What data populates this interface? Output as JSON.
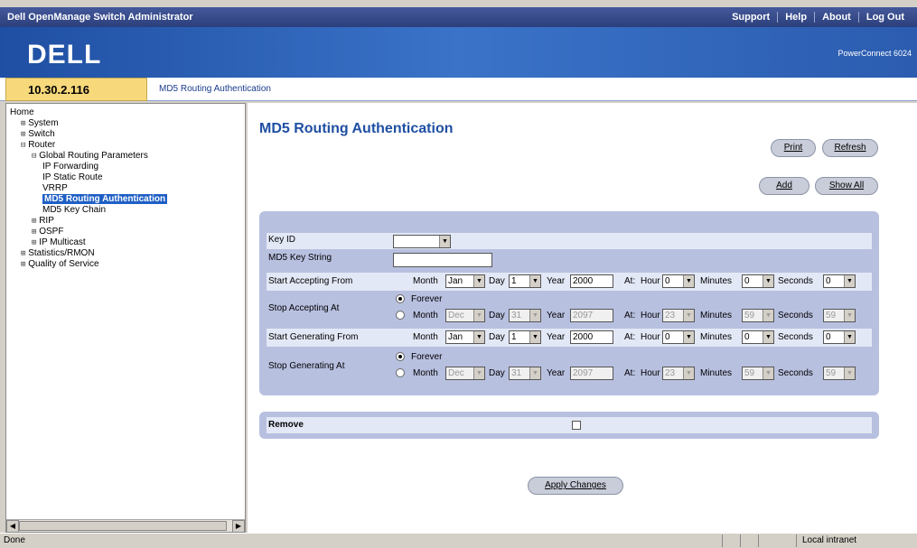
{
  "topbar": {
    "title": "Dell OpenManage Switch Administrator",
    "links": [
      "Support",
      "Help",
      "About",
      "Log Out"
    ]
  },
  "banner": {
    "logo": "DELL",
    "model": "PowerConnect 6024"
  },
  "addr": {
    "ip": "10.30.2.116",
    "breadcrumb": "MD5 Routing Authentication"
  },
  "tree": [
    {
      "label": "Home",
      "indent": 0,
      "exp": ""
    },
    {
      "label": "System",
      "indent": 1,
      "exp": "⊞"
    },
    {
      "label": "Switch",
      "indent": 1,
      "exp": "⊞"
    },
    {
      "label": "Router",
      "indent": 1,
      "exp": "⊟"
    },
    {
      "label": "Global Routing Parameters",
      "indent": 2,
      "exp": "⊟"
    },
    {
      "label": "IP Forwarding",
      "indent": 3,
      "exp": ""
    },
    {
      "label": "IP Static Route",
      "indent": 3,
      "exp": ""
    },
    {
      "label": "VRRP",
      "indent": 3,
      "exp": ""
    },
    {
      "label": "MD5 Routing Authentication",
      "indent": 3,
      "exp": "",
      "selected": true
    },
    {
      "label": "MD5 Key Chain",
      "indent": 3,
      "exp": ""
    },
    {
      "label": "RIP",
      "indent": 2,
      "exp": "⊞"
    },
    {
      "label": "OSPF",
      "indent": 2,
      "exp": "⊞"
    },
    {
      "label": "IP Multicast",
      "indent": 2,
      "exp": "⊞"
    },
    {
      "label": "Statistics/RMON",
      "indent": 1,
      "exp": "⊞"
    },
    {
      "label": "Quality of Service",
      "indent": 1,
      "exp": "⊞"
    }
  ],
  "page": {
    "title": "MD5 Routing Authentication",
    "buttons": {
      "print": "Print",
      "refresh": "Refresh",
      "add": "Add",
      "show_all": "Show All",
      "apply": "Apply Changes"
    },
    "labels": {
      "key_id": "Key ID",
      "md5_key_string": "MD5 Key String",
      "start_accepting": "Start Accepting From",
      "stop_accepting": "Stop Accepting At",
      "start_generating": "Start Generating From",
      "stop_generating": "Stop Generating At",
      "remove": "Remove",
      "forever": "Forever",
      "month": "Month",
      "day": "Day",
      "year": "Year",
      "at": "At:",
      "hour": "Hour",
      "minutes": "Minutes",
      "seconds": "Seconds"
    },
    "start_accepting": {
      "month": "Jan",
      "day": "1",
      "year": "2000",
      "hour": "0",
      "minutes": "0",
      "seconds": "0"
    },
    "stop_accepting": {
      "month": "Dec",
      "day": "31",
      "year": "2097",
      "hour": "23",
      "minutes": "59",
      "seconds": "59"
    },
    "start_generating": {
      "month": "Jan",
      "day": "1",
      "year": "2000",
      "hour": "0",
      "minutes": "0",
      "seconds": "0"
    },
    "stop_generating": {
      "month": "Dec",
      "day": "31",
      "year": "2097",
      "hour": "23",
      "minutes": "59",
      "seconds": "59"
    }
  },
  "status": {
    "left": "Done",
    "zone": "Local intranet"
  }
}
